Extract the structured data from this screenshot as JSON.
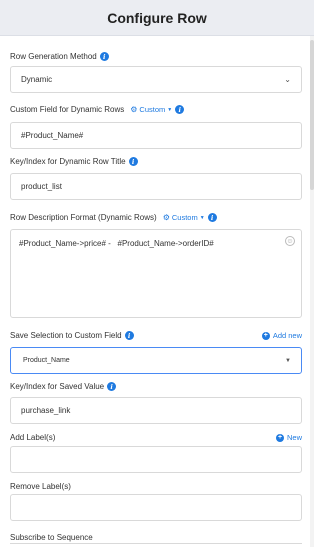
{
  "header": {
    "title": "Configure Row"
  },
  "row_generation": {
    "label": "Row Generation Method",
    "value": "Dynamic"
  },
  "custom_field": {
    "label": "Custom Field for Dynamic Rows",
    "custom_label": "Custom",
    "value": "#Product_Name#"
  },
  "key_index_title": {
    "label": "Key/Index for Dynamic Row Title",
    "value": "product_list"
  },
  "row_description": {
    "label": "Row Description Format (Dynamic Rows)",
    "custom_label": "Custom",
    "value": "#Product_Name->price# -   #Product_Name->orderID#"
  },
  "save_selection": {
    "label": "Save Selection to Custom Field",
    "add_new_label": "Add new",
    "value": "Product_Name"
  },
  "key_index_saved": {
    "label": "Key/Index for Saved Value",
    "value": "purchase_link"
  },
  "add_labels": {
    "label": "Add Label(s)",
    "new_label": "New",
    "value": ""
  },
  "remove_labels": {
    "label": "Remove Label(s)",
    "value": ""
  },
  "subscribe": {
    "label": "Subscribe to Sequence"
  },
  "icons": {
    "info": "info-icon",
    "gear": "gear-icon",
    "chevron": "chevron-down-icon",
    "plus": "plus-circle-icon",
    "emoji": "emoji-icon"
  },
  "colors": {
    "accent": "#1f7ae0",
    "header_bg": "#ebedf2",
    "border": "#d9d9d9",
    "active_border": "#4a8af4"
  }
}
